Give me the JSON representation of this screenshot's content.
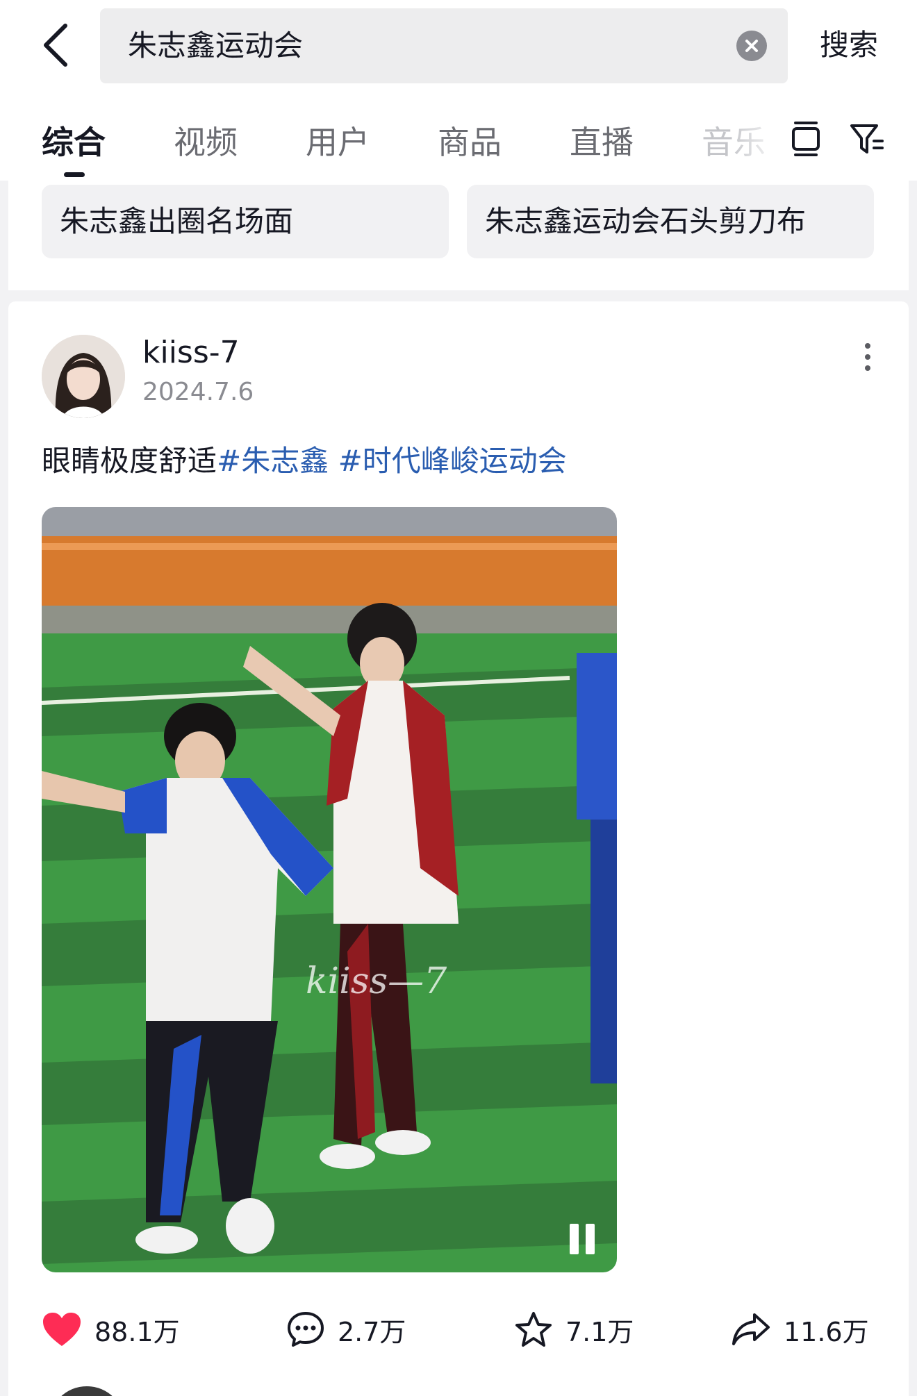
{
  "search": {
    "query": "朱志鑫运动会",
    "submit_label": "搜索"
  },
  "tabs": [
    {
      "label": "综合",
      "active": true
    },
    {
      "label": "视频"
    },
    {
      "label": "用户"
    },
    {
      "label": "商品"
    },
    {
      "label": "直播"
    },
    {
      "label": "音乐"
    }
  ],
  "related_searches": [
    "朱志鑫出圈名场面",
    "朱志鑫运动会石头剪刀布"
  ],
  "post": {
    "username": "kiiss-7",
    "date": "2024.7.6",
    "caption_text": "眼睛极度舒适",
    "hashtags": [
      "#朱志鑫",
      "#时代峰峻运动会"
    ],
    "video_watermark": "kiiss—7",
    "stats": {
      "likes": "88.1万",
      "comments": "2.7万",
      "favorites": "7.1万",
      "shares": "11.6万"
    }
  },
  "colors": {
    "like": "#fe2c55",
    "hashtag": "#2a5db0",
    "text": "#161823",
    "muted": "#8a8b91"
  },
  "icons": [
    "back-icon",
    "clear-icon",
    "layout-toggle-icon",
    "filter-icon",
    "more-icon",
    "heart-icon",
    "comment-icon",
    "star-icon",
    "share-icon",
    "pause-icon"
  ]
}
